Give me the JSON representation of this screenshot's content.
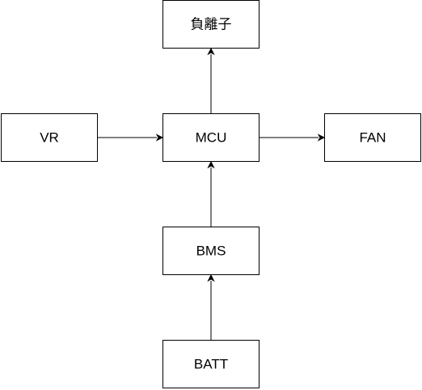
{
  "diagram": {
    "nodes": {
      "ion": "負離子",
      "vr": "VR",
      "mcu": "MCU",
      "fan": "FAN",
      "bms": "BMS",
      "batt": "BATT"
    },
    "edges": [
      {
        "from": "vr",
        "to": "mcu"
      },
      {
        "from": "mcu",
        "to": "fan"
      },
      {
        "from": "mcu",
        "to": "ion"
      },
      {
        "from": "bms",
        "to": "mcu"
      },
      {
        "from": "batt",
        "to": "bms"
      }
    ]
  }
}
